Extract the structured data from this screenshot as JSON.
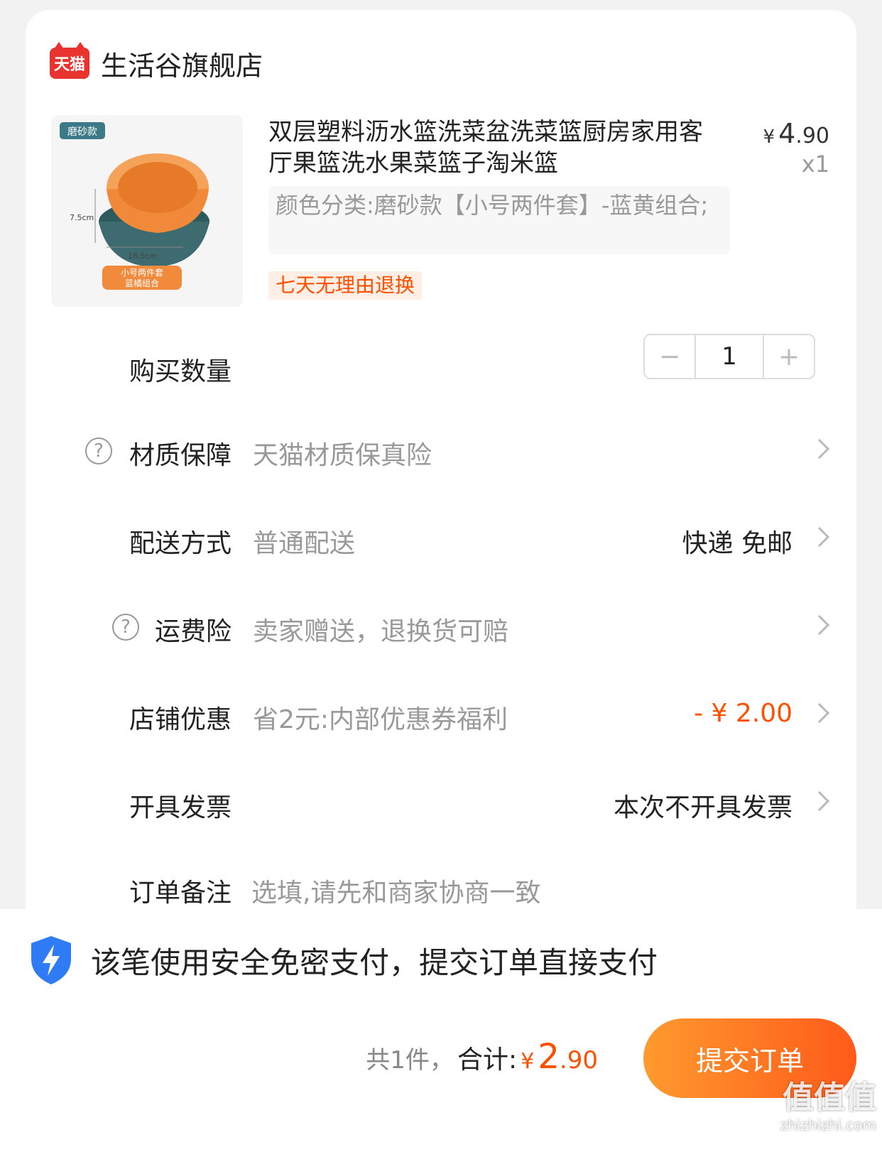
{
  "store": {
    "badge": "天猫",
    "name": "生活谷旗舰店"
  },
  "product": {
    "title": "双层塑料沥水篮洗菜盆洗菜篮厨房家用客厅果篮洗水果菜篮子淘米篮",
    "price_symbol": "¥",
    "price_int": "4",
    "price_dec": ".90",
    "quantity": "x1",
    "sku": "颜色分类:磨砂款【小号两件套】-蓝黄组合;",
    "tag": "七天无理由退换",
    "image": {
      "badge": "磨砂款",
      "height_label": "7.5cm",
      "width_label": "16.5cm",
      "caption_line1": "小号两件套",
      "caption_line2": "蓝橘组合",
      "colors": {
        "inner": "#f08a3a",
        "outer": "#3d6b6f",
        "caption_bg": "#f28a3c",
        "badge_bg": "#3b7a86"
      }
    }
  },
  "rows": {
    "quantity": {
      "label": "购买数量",
      "minus": "−",
      "value": "1",
      "plus": "+"
    },
    "material": {
      "label": "材质保障",
      "value": "天猫材质保真险"
    },
    "delivery": {
      "label": "配送方式",
      "value": "普通配送",
      "right": "快递 免邮"
    },
    "shipping_insurance": {
      "label": "运费险",
      "value": "卖家赠送，退换货可赔"
    },
    "store_discount": {
      "label": "店铺优惠",
      "value": "省2元:内部优惠券福利",
      "right": "- ¥ 2.00"
    },
    "invoice": {
      "label": "开具发票",
      "right": "本次不开具发票"
    },
    "note": {
      "label": "订单备注",
      "placeholder": "选填,请先和商家协商一致"
    }
  },
  "footer": {
    "secure_text": "该笔使用安全免密支付，提交订单直接支付",
    "count_text": "共1件，",
    "total_label": "合计:",
    "total_symbol": "¥",
    "total_int": "2",
    "total_dec": ".90",
    "submit_label": "提交订单"
  },
  "watermark": {
    "text": "值值值",
    "site": "zhizhizhi.com"
  },
  "colors": {
    "accent": "#ff5000",
    "brand_red": "#e8332f",
    "shield_blue": "#2f7bf5"
  }
}
